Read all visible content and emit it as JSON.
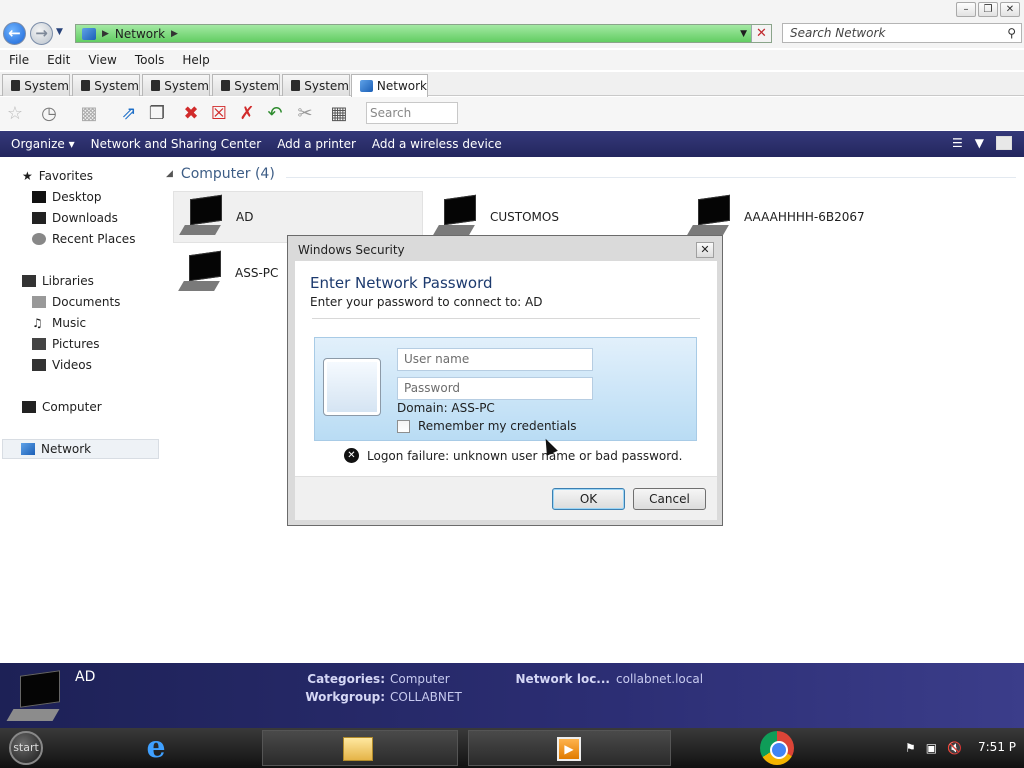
{
  "window": {
    "minimize_glyph": "–",
    "maximize_glyph": "❐",
    "close_glyph": "✕"
  },
  "address": {
    "crumb": "Network",
    "search_placeholder": "Search Network"
  },
  "menu": [
    "File",
    "Edit",
    "View",
    "Tools",
    "Help"
  ],
  "tabs": [
    "System",
    "System",
    "System",
    "System",
    "System",
    "Network"
  ],
  "toolbar": {
    "search_placeholder": "Search"
  },
  "command_bar": {
    "organize": "Organize ▾",
    "items": [
      "Network and Sharing Center",
      "Add a printer",
      "Add a wireless device"
    ]
  },
  "nav": {
    "favorites": "Favorites",
    "desktop": "Desktop",
    "downloads": "Downloads",
    "recent": "Recent Places",
    "libraries": "Libraries",
    "documents": "Documents",
    "music": "Music",
    "pictures": "Pictures",
    "videos": "Videos",
    "computer": "Computer",
    "network": "Network"
  },
  "content": {
    "group_title": "Computer (4)",
    "computers": [
      "AD",
      "CUSTOMOS",
      "AAAAHHHH-6B2067",
      "ASS-PC"
    ]
  },
  "dialog": {
    "title": "Windows Security",
    "heading": "Enter Network Password",
    "subtitle": "Enter your password to connect to: AD",
    "username_placeholder": "User name",
    "password_placeholder": "Password",
    "domain": "Domain: ASS-PC",
    "remember": "Remember my credentials",
    "error": "Logon failure: unknown user name or bad password.",
    "ok": "OK",
    "cancel": "Cancel"
  },
  "details": {
    "name": "AD",
    "categories_label": "Categories:",
    "categories_value": "Computer",
    "workgroup_label": "Workgroup:",
    "workgroup_value": "COLLABNET",
    "netloc_label": "Network loc...",
    "netloc_value": "collabnet.local"
  },
  "taskbar": {
    "start": "start",
    "ie_glyph": "e",
    "clock": "7:51 P"
  },
  "colors": {
    "address_green": "#62cd62",
    "command_bar": "#23265e",
    "details_bg": "#2c2e74"
  }
}
